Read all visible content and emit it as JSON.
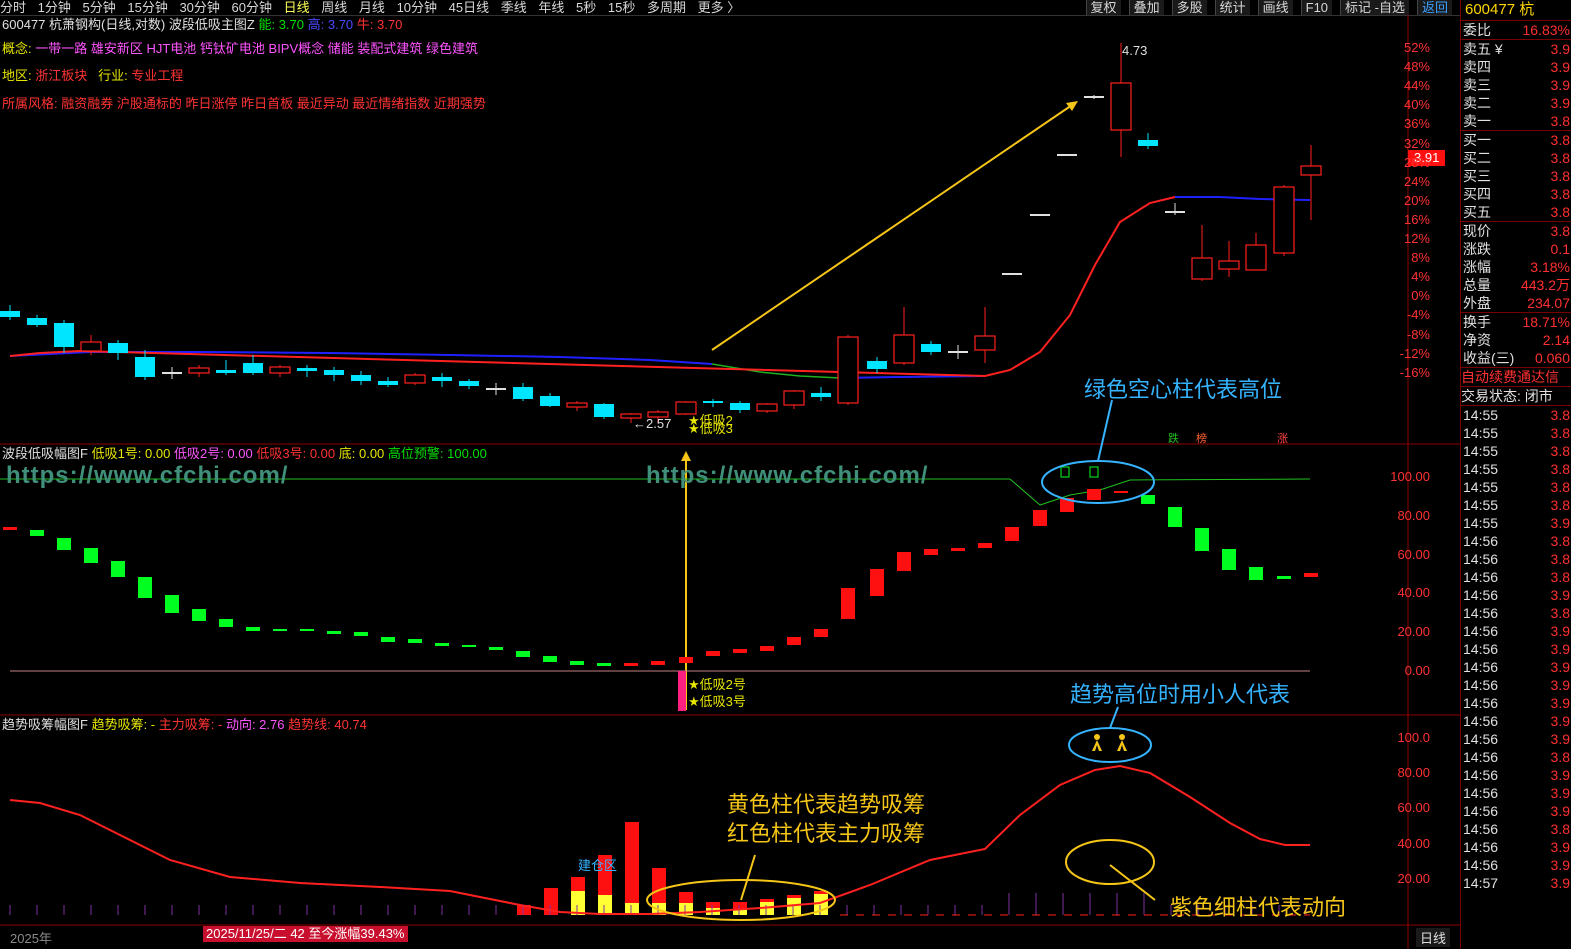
{
  "toolbar": {
    "periods": [
      "分时",
      "1分钟",
      "5分钟",
      "15分钟",
      "30分钟",
      "60分钟",
      "日线",
      "周线",
      "月线",
      "10分钟",
      "45日线",
      "季线",
      "年线",
      "5秒",
      "15秒",
      "多周期",
      "更多 〉"
    ],
    "active_period": "日线",
    "right_tools": [
      "复权",
      "叠加",
      "多股",
      "统计",
      "画线",
      "F10",
      "标记 -自选",
      "返回"
    ]
  },
  "main_panel": {
    "title_stock": "600477 杭萧钢构(日线,对数)",
    "indicator": "波段低吸主图Z",
    "neng": "能: 3.70",
    "gao": "高: 3.70",
    "niu": "牛: 3.70",
    "concept_label": "概念:",
    "concepts": "一带一路  雄安新区  HJT电池  钙钛矿电池  BIPV概念  储能  装配式建筑  绿色建筑",
    "region_label": "地区:",
    "region": "浙江板块",
    "industry_label": "行业:",
    "industry": "专业工程",
    "style_label": "所属风格:",
    "styles": "融资融券  沪股通标的  昨日涨停  昨日首板  最近异动  最近情绪指数  近期强势",
    "high_label": "4.73",
    "low_label": "←2.57",
    "low_tags": [
      "★低吸2",
      "★低吸3"
    ],
    "price_tag": "3.91",
    "y_ticks": [
      "52%",
      "48%",
      "44%",
      "40%",
      "36%",
      "32%",
      "28%",
      "24%",
      "20%",
      "16%",
      "12%",
      "8%",
      "4%",
      "0%",
      "-4%",
      "-8%",
      "-12%",
      "-16%"
    ],
    "signals": [
      "跌",
      "榜",
      "涨"
    ],
    "annotation": "绿色空心柱代表高位"
  },
  "panel2": {
    "title": "波段低吸幅图F",
    "items": [
      "低吸1号: 0.00",
      "低吸2号: 0.00",
      "低吸3号: 0.00",
      "底: 0.00",
      "高位预警: 100.00"
    ],
    "tags": [
      "★低吸2号",
      "★低吸3号"
    ],
    "y_ticks": [
      "100.00",
      "80.00",
      "60.00",
      "40.00",
      "20.00",
      "0.00"
    ],
    "watermark": "https://www.cfchi.com/",
    "annotation": "趋势高位时用小人代表"
  },
  "panel3": {
    "title": "趋势吸筹幅图F",
    "items": [
      "趋势吸筹: -",
      "主力吸筹: -",
      "动向: 2.76",
      "趋势线: 40.74"
    ],
    "jiancang": "建仓区",
    "y_ticks": [
      "100.0",
      "80.00",
      "60.00",
      "40.00",
      "20.00"
    ],
    "annot_yellow_1": "黄色柱代表趋势吸筹",
    "annot_yellow_2": "红色柱代表主力吸筹",
    "annot_purple": "紫色细柱代表动向"
  },
  "footer": {
    "year": "2025年",
    "date_box": "2025/11/25/二 42 至今涨幅39.43%",
    "tab": "日线"
  },
  "quote": {
    "code": "600477 杭",
    "weibi_label": "委比",
    "weibi": "16.83%",
    "asks": [
      [
        "卖五 ¥",
        "3.9"
      ],
      [
        "卖四",
        "3.9"
      ],
      [
        "卖三",
        "3.9"
      ],
      [
        "卖二",
        "3.9"
      ],
      [
        "卖一",
        "3.8"
      ]
    ],
    "bids": [
      [
        "买一",
        "3.8"
      ],
      [
        "买二",
        "3.8"
      ],
      [
        "买三",
        "3.8"
      ],
      [
        "买四",
        "3.8"
      ],
      [
        "买五",
        "3.8"
      ]
    ],
    "stats": [
      [
        "现价",
        "3.8"
      ],
      [
        "涨跌",
        "0.1"
      ],
      [
        "涨幅",
        "3.18%"
      ],
      [
        "总量",
        "443.2万"
      ],
      [
        "外盘",
        "234.07"
      ]
    ],
    "stats2": [
      [
        "换手",
        "18.71%"
      ],
      [
        "净资",
        "2.14"
      ],
      [
        "收益(三)",
        "0.060"
      ]
    ],
    "notice": "自动续费通达信",
    "trade_status": "交易状态: 闭市",
    "ticks": [
      [
        "14:55",
        "3.8"
      ],
      [
        "14:55",
        "3.8"
      ],
      [
        "14:55",
        "3.8"
      ],
      [
        "14:55",
        "3.8"
      ],
      [
        "14:55",
        "3.8"
      ],
      [
        "14:55",
        "3.8"
      ],
      [
        "14:55",
        "3.9"
      ],
      [
        "14:56",
        "3.8"
      ],
      [
        "14:56",
        "3.8"
      ],
      [
        "14:56",
        "3.8"
      ],
      [
        "14:56",
        "3.9"
      ],
      [
        "14:56",
        "3.8"
      ],
      [
        "14:56",
        "3.9"
      ],
      [
        "14:56",
        "3.9"
      ],
      [
        "14:56",
        "3.9"
      ],
      [
        "14:56",
        "3.9"
      ],
      [
        "14:56",
        "3.9"
      ],
      [
        "14:56",
        "3.9"
      ],
      [
        "14:56",
        "3.9"
      ],
      [
        "14:56",
        "3.8"
      ],
      [
        "14:56",
        "3.9"
      ],
      [
        "14:56",
        "3.9"
      ],
      [
        "14:56",
        "3.9"
      ],
      [
        "14:56",
        "3.8"
      ],
      [
        "14:56",
        "3.9"
      ],
      [
        "14:56",
        "3.9"
      ],
      [
        "14:57",
        "3.9"
      ]
    ],
    "colors": {
      "up": "#ff3030",
      "down": "#00e0e0",
      "accent": "#ffd700"
    }
  }
}
